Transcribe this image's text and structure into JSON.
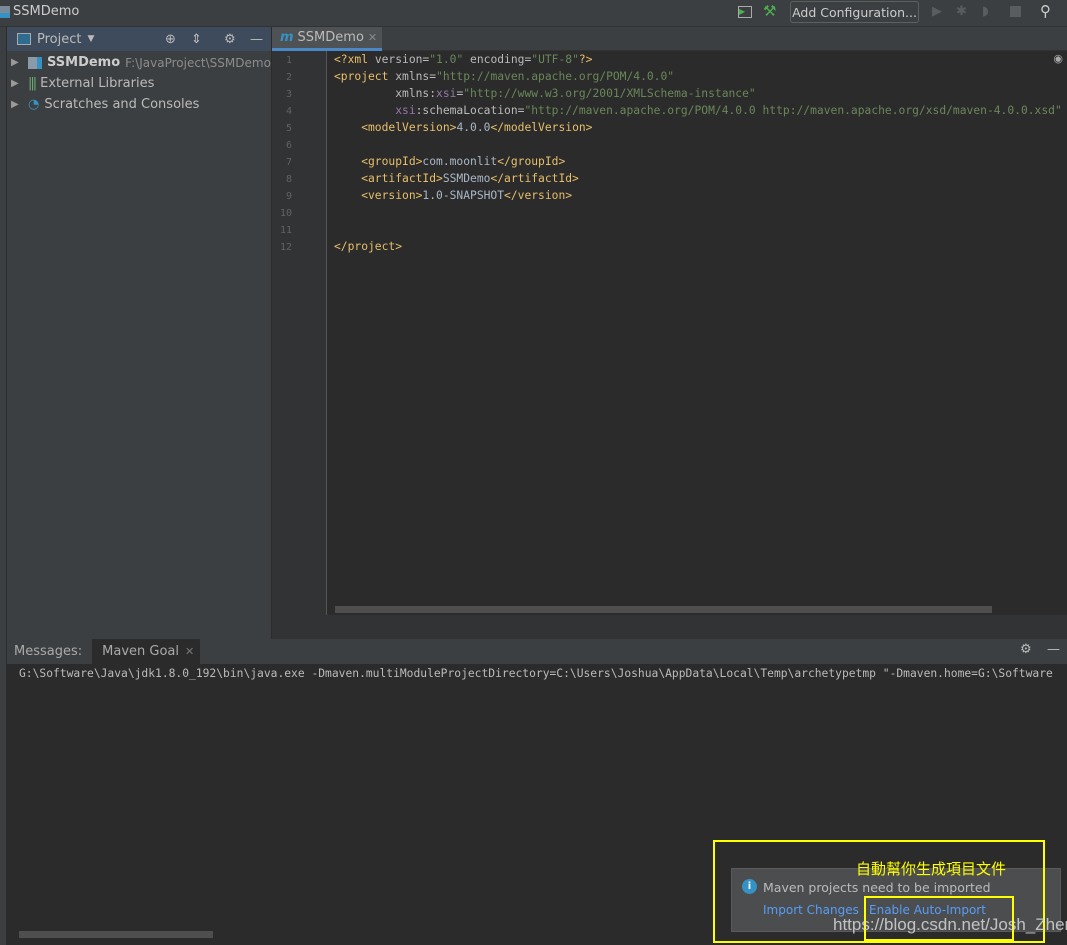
{
  "title": "SSMDemo",
  "toolbar": {
    "add_config": "Add Configuration..."
  },
  "project": {
    "label": "Project",
    "items": [
      {
        "name": "SSMDemo",
        "path": "F:\\JavaProject\\SSMDemo"
      },
      {
        "name": "External Libraries"
      },
      {
        "name": "Scratches and Consoles"
      }
    ]
  },
  "editor": {
    "tab": "SSMDemo",
    "lines": [
      [
        [
          "tag",
          "<?xml "
        ],
        [
          "attr",
          "version="
        ],
        [
          "str",
          "\"1.0\""
        ],
        [
          "attr",
          " encoding="
        ],
        [
          "str",
          "\"UTF-8\""
        ],
        [
          "tag",
          "?>"
        ]
      ],
      [
        [
          "tag",
          "<project "
        ],
        [
          "attr",
          "xmlns="
        ],
        [
          "str",
          "\"http://maven.apache.org/POM/4.0.0\""
        ]
      ],
      [
        [
          "attr",
          "         xmlns:"
        ],
        [
          "ns",
          "xsi"
        ],
        [
          "attr",
          "="
        ],
        [
          "str",
          "\"http://www.w3.org/2001/XMLSchema-instance\""
        ]
      ],
      [
        [
          "ns",
          "         xsi"
        ],
        [
          "attr",
          ":schemaLocation="
        ],
        [
          "str",
          "\"http://maven.apache.org/POM/4.0.0 http://maven.apache.org/xsd/maven-4.0.0.xsd\""
        ]
      ],
      [
        [
          "tag",
          "    <modelVersion>"
        ],
        [
          "txt",
          "4.0.0"
        ],
        [
          "tag",
          "</modelVersion>"
        ]
      ],
      [],
      [
        [
          "tag",
          "    <groupId>"
        ],
        [
          "txt",
          "com.moonlit"
        ],
        [
          "tag",
          "</groupId>"
        ]
      ],
      [
        [
          "tag",
          "    <artifactId>"
        ],
        [
          "txt",
          "SSMDemo"
        ],
        [
          "tag",
          "</artifactId>"
        ]
      ],
      [
        [
          "tag",
          "    <version>"
        ],
        [
          "txt",
          "1.0-SNAPSHOT"
        ],
        [
          "tag",
          "</version>"
        ]
      ],
      [],
      [],
      [
        [
          "tag",
          "</project>"
        ]
      ]
    ]
  },
  "bottom": {
    "messages": "Messages:",
    "tab": "Maven Goal",
    "console": "G:\\Software\\Java\\jdk1.8.0_192\\bin\\java.exe -Dmaven.multiModuleProjectDirectory=C:\\Users\\Joshua\\AppData\\Local\\Temp\\archetypetmp \"-Dmaven.home=G:\\Software"
  },
  "notification": {
    "message": "Maven projects need to be imported",
    "import": "Import Changes",
    "auto": "Enable Auto-Import"
  },
  "annotation": "自動幫你生成項目文件",
  "watermark": "https://blog.csdn.net/Josh_Zhen"
}
